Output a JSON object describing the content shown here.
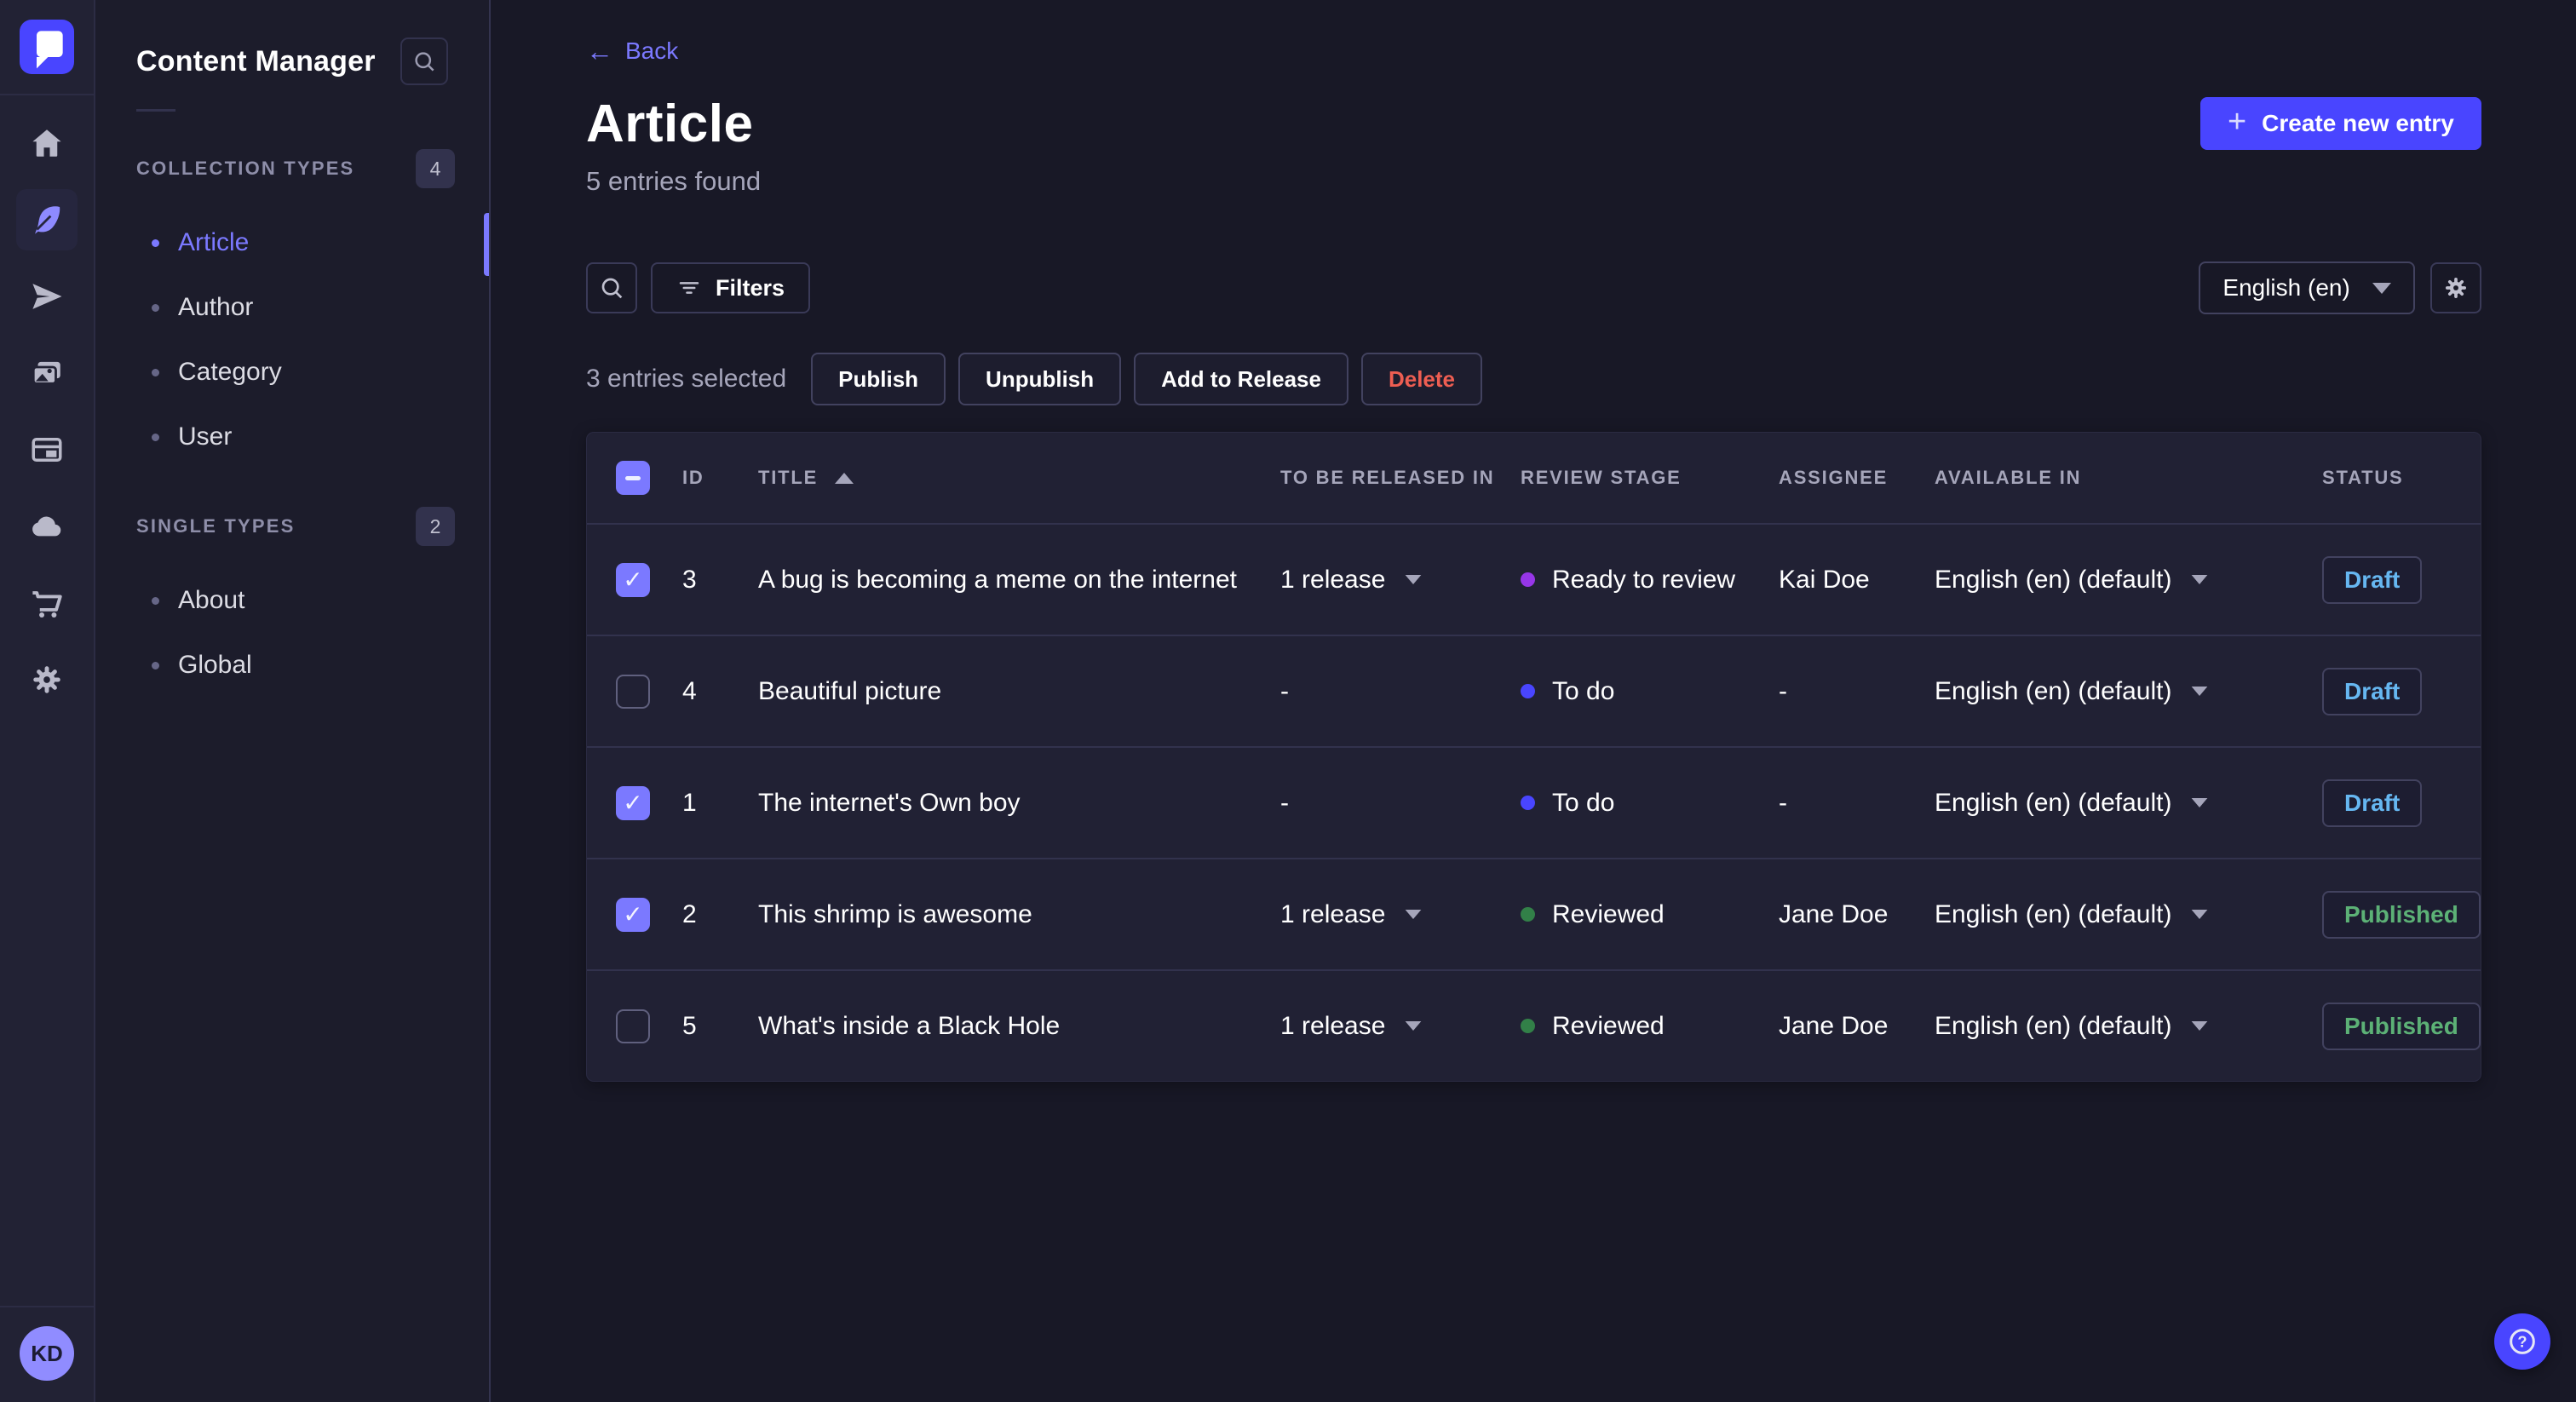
{
  "colors": {
    "brand": "#4945ff",
    "link_active": "#7b79ff",
    "draft": "#66b7f1",
    "published": "#5cb176",
    "danger": "#ee5e52",
    "stage_ready": "#9736e8",
    "stage_todo": "#4945ff",
    "stage_reviewed": "#328048"
  },
  "rail": {
    "icons": [
      {
        "name": "home"
      },
      {
        "name": "content-manager-feather",
        "active": true
      },
      {
        "name": "releases-paper-plane"
      },
      {
        "name": "media-library-images"
      },
      {
        "name": "content-type-builder-layout"
      },
      {
        "name": "deploy-cloud"
      },
      {
        "name": "marketplace-cart"
      },
      {
        "name": "settings-gear"
      }
    ],
    "avatar_initials": "KD"
  },
  "sidebar": {
    "title": "Content Manager",
    "sections": [
      {
        "label": "COLLECTION TYPES",
        "count": "4",
        "items": [
          {
            "label": "Article",
            "active": true
          },
          {
            "label": "Author"
          },
          {
            "label": "Category"
          },
          {
            "label": "User"
          }
        ]
      },
      {
        "label": "SINGLE TYPES",
        "count": "2",
        "items": [
          {
            "label": "About"
          },
          {
            "label": "Global"
          }
        ]
      }
    ]
  },
  "header": {
    "back_label": "Back",
    "back_arrow": "←",
    "title": "Article",
    "subtitle": "5 entries found",
    "create_label": "Create new entry",
    "create_plus": "+"
  },
  "toolbar": {
    "filters_label": "Filters",
    "locale_value": "English (en)"
  },
  "selection": {
    "text": "3 entries selected",
    "publish_label": "Publish",
    "unpublish_label": "Unpublish",
    "add_to_release_label": "Add to Release",
    "delete_label": "Delete"
  },
  "table": {
    "columns": [
      "ID",
      "TITLE",
      "TO BE RELEASED IN",
      "REVIEW STAGE",
      "ASSIGNEE",
      "AVAILABLE IN",
      "STATUS"
    ],
    "rows": [
      {
        "checked": true,
        "id": "3",
        "title": "A bug is becoming a meme on the internet",
        "to_be_released_in": "1 release",
        "review_stage": "Ready to review",
        "stage_color": "#9736e8",
        "assignee": "Kai Doe",
        "available_in": "English (en) (default)",
        "status": "Draft"
      },
      {
        "checked": false,
        "id": "4",
        "title": "Beautiful picture",
        "to_be_released_in": "-",
        "review_stage": "To do",
        "stage_color": "#4945ff",
        "assignee": "-",
        "available_in": "English (en) (default)",
        "status": "Draft"
      },
      {
        "checked": true,
        "id": "1",
        "title": "The internet's Own boy",
        "to_be_released_in": "-",
        "review_stage": "To do",
        "stage_color": "#4945ff",
        "assignee": "-",
        "available_in": "English (en) (default)",
        "status": "Draft"
      },
      {
        "checked": true,
        "id": "2",
        "title": "This shrimp is awesome",
        "to_be_released_in": "1 release",
        "review_stage": "Reviewed",
        "stage_color": "#328048",
        "assignee": "Jane Doe",
        "available_in": "English (en) (default)",
        "status": "Published"
      },
      {
        "checked": false,
        "id": "5",
        "title": "What's inside a Black Hole",
        "to_be_released_in": "1 release",
        "review_stage": "Reviewed",
        "stage_color": "#328048",
        "assignee": "Jane Doe",
        "available_in": "English (en) (default)",
        "status": "Published"
      }
    ]
  }
}
